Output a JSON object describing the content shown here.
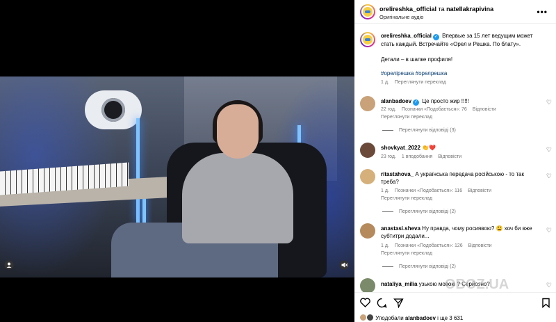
{
  "header": {
    "user": "orelireshka_official",
    "and": " та ",
    "coauthor": "natellakrapivina",
    "audio": "Оригінальне аудіо",
    "more": "•••"
  },
  "caption": {
    "user": "orelireshka_official",
    "text": "Впервые за 15 лет ведущим может стать каждый. Встречайте «Орел и Решка. По блату».",
    "details": "Детали – в шапке профиля!",
    "hashtags": "#орелірешка #орелрешка",
    "time": "1 д.",
    "see_translation": "Переглянути переклад"
  },
  "comments": [
    {
      "user": "alanbadoev",
      "text": "Це просто жир !!!!!",
      "time": "22 год.",
      "likes": "Позначки «Подобається»: 76",
      "reply": "Відповісти",
      "see_translation": "Переглянути переклад",
      "replies": "Переглянути відповіді (3)"
    },
    {
      "user": "shovkyat_2022",
      "text": "👏❤️",
      "time": "23 год.",
      "likes": "1 вподобання",
      "reply": "Відповісти"
    },
    {
      "user": "ritastahova_",
      "text": "А українська передача російською - то так треба?",
      "time": "1 д.",
      "likes": "Позначки «Подобається»: 116",
      "reply": "Відповісти",
      "see_translation": "Переглянути переклад",
      "replies": "Переглянути відповіді (2)"
    },
    {
      "user": "anastasi.sheva",
      "text": "Ну правда, чому росиявою? 😩 хоч би вже субтитри додали...",
      "time": "1 д.",
      "likes": "Позначки «Подобається»: 126",
      "reply": "Відповісти",
      "see_translation": "Переглянути переклад",
      "replies": "Переглянути відповіді (2)"
    },
    {
      "user": "nataliya_milia",
      "text": "узькою мовою ? Серйозно?"
    }
  ],
  "footer": {
    "liked_by_prefix": "Уподобали ",
    "liked_by_user": "alanbadoev",
    "liked_by_suffix": " і ще 3 631"
  },
  "watermark": "OBOZ.UA",
  "icons": {
    "heart": "♡",
    "comment": "◯",
    "share": "➤",
    "save": "⎕"
  }
}
